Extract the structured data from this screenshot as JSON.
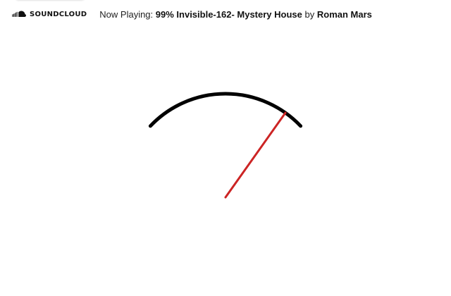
{
  "header": {
    "brand": {
      "icon": "soundcloud-icon",
      "label": "SOUNDCLOUD"
    },
    "now_playing": {
      "label": "Now Playing:",
      "title": "99% Invisible-162- Mystery House",
      "connector": "by",
      "artist": "Roman Mars"
    }
  },
  "gauge": {
    "needle_position_fraction": 0.88,
    "arc_color": "#000000",
    "needle_color": "#cc2424"
  }
}
